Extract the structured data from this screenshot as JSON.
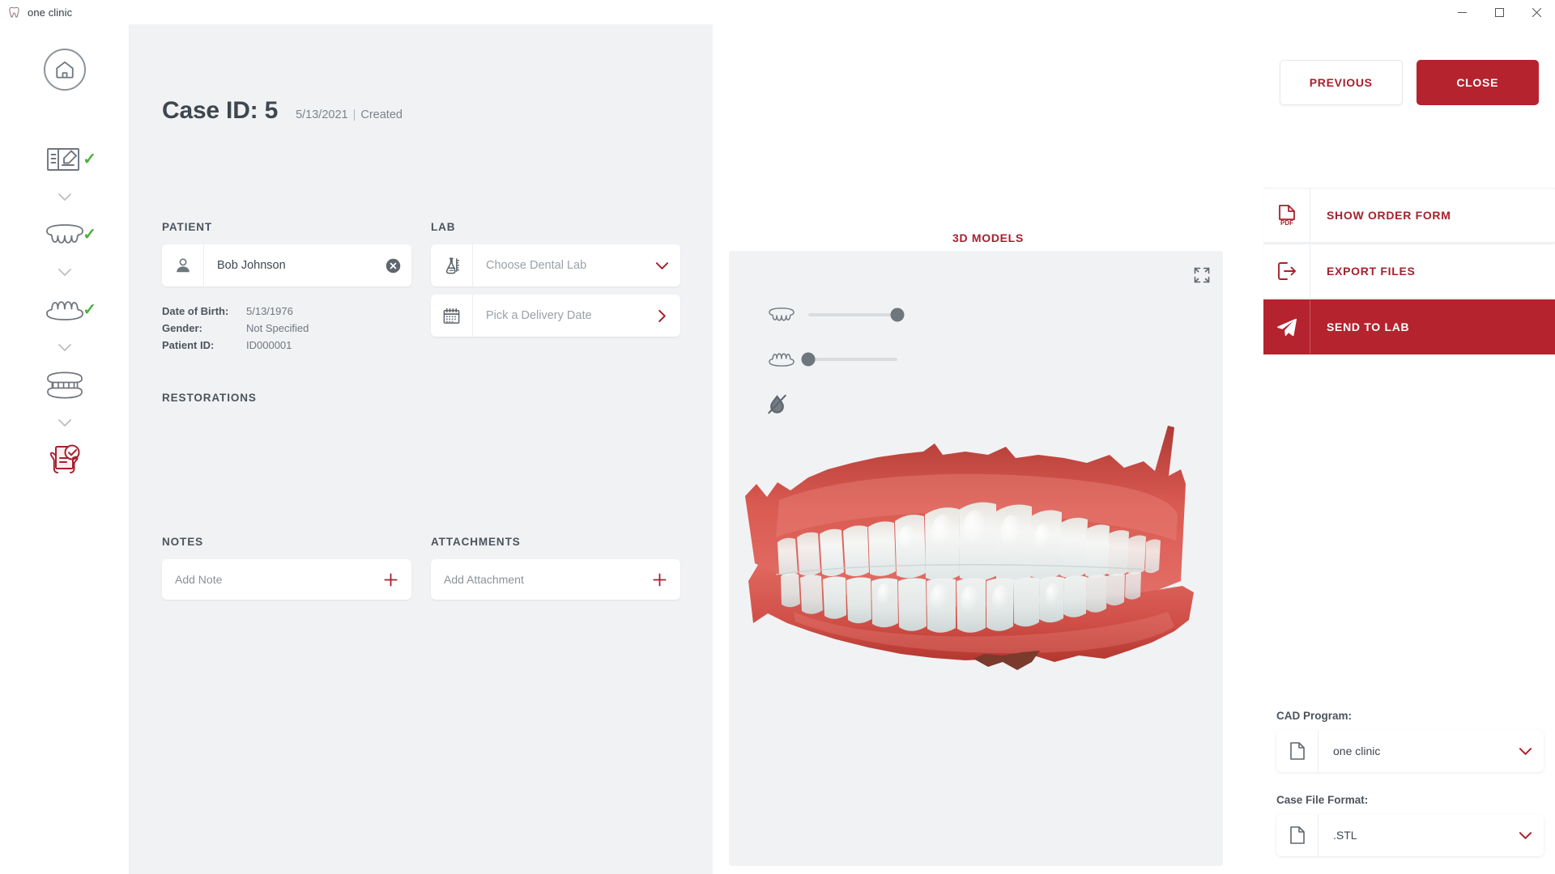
{
  "titlebar": {
    "app_name": "one clinic",
    "logo_icon": "tooth-icon",
    "minimize_icon": "minimize-icon",
    "maximize_icon": "maximize-icon",
    "close_icon": "close-icon"
  },
  "sidebar": {
    "home_icon": "home-icon",
    "steps": [
      {
        "icon": "order-form-icon",
        "name": "step-order-form",
        "completed": true,
        "check": "✓",
        "chevron": "chevron-down-icon"
      },
      {
        "icon": "upper-jaw-icon",
        "name": "step-upper-jaw",
        "completed": true,
        "check": "✓",
        "chevron": "chevron-down-icon"
      },
      {
        "icon": "lower-jaw-icon",
        "name": "step-lower-jaw",
        "completed": true,
        "check": "✓",
        "chevron": "chevron-down-icon"
      },
      {
        "icon": "bite-icon",
        "name": "step-bite",
        "completed": false,
        "check": "",
        "chevron": "chevron-down-icon"
      },
      {
        "icon": "case-approval-icon",
        "name": "step-case-approval",
        "completed": false,
        "check": "",
        "chevron": ""
      }
    ]
  },
  "case": {
    "title": "Case ID: 5",
    "date": "5/13/2021",
    "separator": "|",
    "status": "Created"
  },
  "patient": {
    "section_label": "PATIENT",
    "icon": "person-icon",
    "name": "Bob Johnson",
    "clear_icon": "clear-circle-icon",
    "fields": [
      {
        "key": "Date of Birth:",
        "value": "5/13/1976"
      },
      {
        "key": "Gender:",
        "value": "Not Specified"
      },
      {
        "key": "Patient ID:",
        "value": "ID000001"
      }
    ]
  },
  "lab": {
    "section_label": "LAB",
    "choose_lab": {
      "icon": "flask-icon",
      "placeholder": "Choose Dental Lab",
      "chevron": "chevron-down-icon"
    },
    "delivery_date": {
      "icon": "calendar-icon",
      "placeholder": "Pick a Delivery Date",
      "chevron": "chevron-right-icon"
    }
  },
  "restorations": {
    "section_label": "RESTORATIONS"
  },
  "notes": {
    "section_label": "NOTES",
    "add_label": "Add Note",
    "add_icon": "plus-icon"
  },
  "attachments": {
    "section_label": "ATTACHMENTS",
    "add_label": "Add Attachment",
    "add_icon": "plus-icon"
  },
  "viewer": {
    "title": "3D MODELS",
    "expand_icon": "expand-icon",
    "sliders": [
      {
        "name": "upper-jaw-opacity-slider",
        "icon": "upper-jaw-icon",
        "value": 100
      },
      {
        "name": "lower-jaw-opacity-slider",
        "icon": "lower-jaw-icon",
        "value": 0
      }
    ],
    "visibility_toggle_icon": "eye-off-icon",
    "model_alt": "3d-dental-scan"
  },
  "right_panel": {
    "previous_label": "PREVIOUS",
    "close_label": "CLOSE",
    "actions": [
      {
        "name": "show-order-form-button",
        "icon": "pdf-icon",
        "label": "SHOW ORDER FORM",
        "primary": false
      },
      {
        "name": "export-files-button",
        "icon": "export-icon",
        "label": "EXPORT FILES",
        "primary": false
      },
      {
        "name": "send-to-lab-button",
        "icon": "send-icon",
        "label": "SEND TO LAB",
        "primary": true
      }
    ],
    "cad_program": {
      "label": "CAD Program:",
      "icon": "file-icon",
      "value": "one clinic",
      "chevron": "chevron-down-icon"
    },
    "case_file_format": {
      "label": "Case File Format:",
      "icon": "file-icon",
      "value": ".STL",
      "chevron": "chevron-down-icon"
    }
  },
  "colors": {
    "accent_red": "#b5232e",
    "accent_red_text": "#a8202e",
    "panel_bg": "#f1f2f4",
    "text_dark": "#3e4750",
    "text_muted": "#7b848c",
    "check_green": "#4caf3e",
    "icon_gray": "#6e767e"
  }
}
